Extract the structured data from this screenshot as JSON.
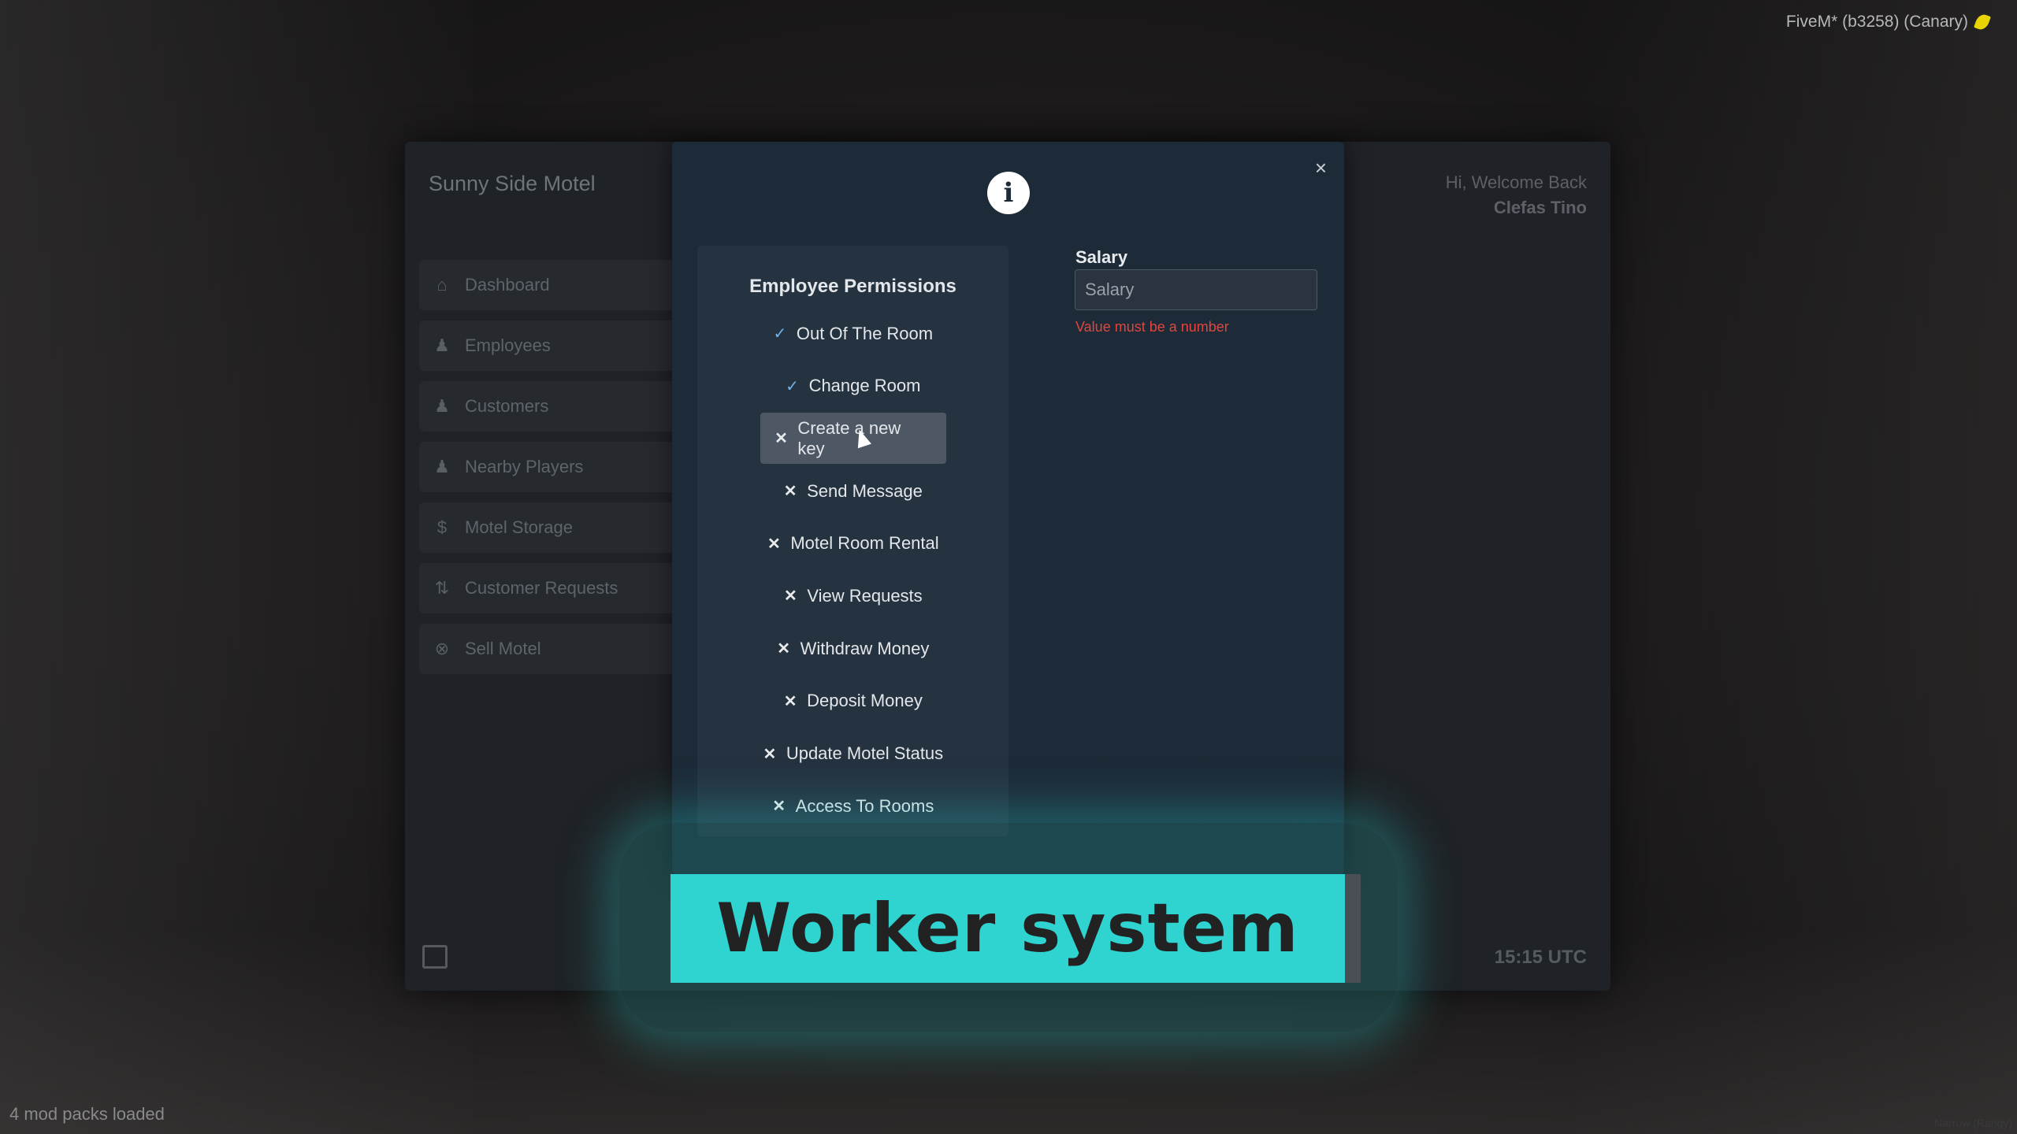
{
  "overlay": {
    "fivem_label": "FiveM* (b3258) (Canary)",
    "mod_packs": "4 mod packs loaded",
    "watermark": "Narrow (Rangy)"
  },
  "app": {
    "title": "Sunny Side Motel",
    "welcome": "Hi, Welcome Back",
    "user_name": "Clefas Tino",
    "clock": "15:15 UTC",
    "sidebar": [
      {
        "label": "Dashboard",
        "icon": "home-icon"
      },
      {
        "label": "Employees",
        "icon": "users-icon"
      },
      {
        "label": "Customers",
        "icon": "users-icon"
      },
      {
        "label": "Nearby Players",
        "icon": "group-icon"
      },
      {
        "label": "Motel Storage",
        "icon": "dollar-icon"
      },
      {
        "label": "Customer Requests",
        "icon": "request-icon"
      },
      {
        "label": "Sell Motel",
        "icon": "close-circle-icon"
      }
    ]
  },
  "modal": {
    "close_glyph": "×",
    "info_glyph": "i",
    "permissions_title": "Employee Permissions",
    "permissions": [
      {
        "label": "Out Of The Room",
        "enabled": true
      },
      {
        "label": "Change Room",
        "enabled": true
      },
      {
        "label": "Create a new key",
        "enabled": false,
        "selected": true
      },
      {
        "label": "Send Message",
        "enabled": false
      },
      {
        "label": "Motel Room Rental",
        "enabled": false
      },
      {
        "label": "View Requests",
        "enabled": false
      },
      {
        "label": "Withdraw Money",
        "enabled": false
      },
      {
        "label": "Deposit Money",
        "enabled": false
      },
      {
        "label": "Update Motel Status",
        "enabled": false
      },
      {
        "label": "Access To Rooms",
        "enabled": false
      }
    ],
    "salary_label": "Salary",
    "salary_placeholder": "Salary",
    "salary_value": "",
    "salary_error": "Value must be a number"
  },
  "banner": {
    "text": "Worker system",
    "color": "#2fd3d0"
  }
}
